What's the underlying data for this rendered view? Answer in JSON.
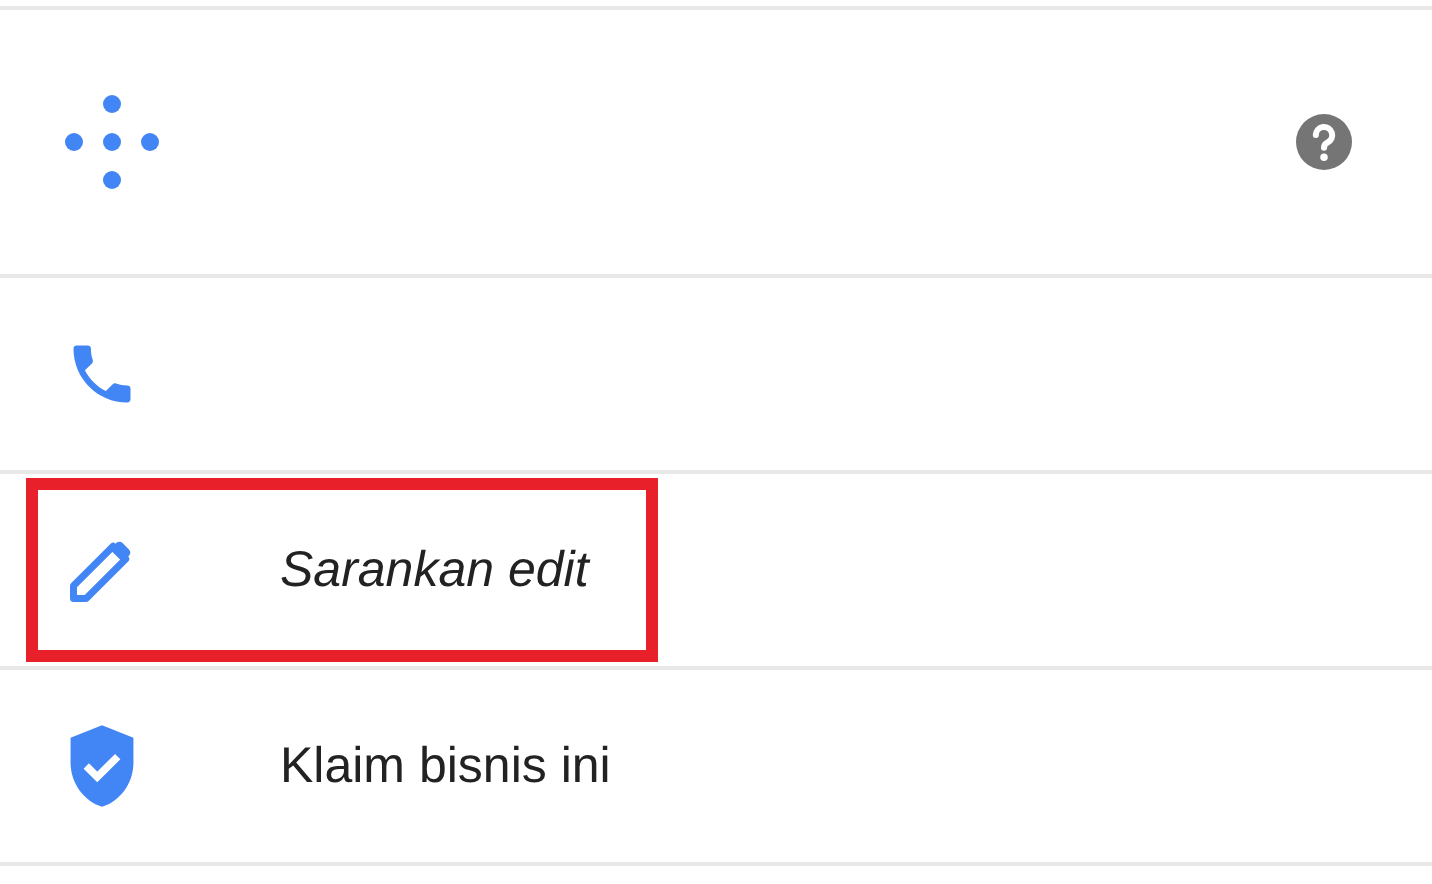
{
  "rows": [
    {
      "kind": "plus-code",
      "highlighted": false,
      "help": true
    },
    {
      "kind": "phone",
      "highlighted": false,
      "help": false
    },
    {
      "kind": "edit",
      "label": "Sarankan edit",
      "highlighted": true,
      "help": false
    },
    {
      "kind": "claim",
      "label": "Klaim bisnis ini",
      "highlighted": false,
      "help": false
    }
  ]
}
